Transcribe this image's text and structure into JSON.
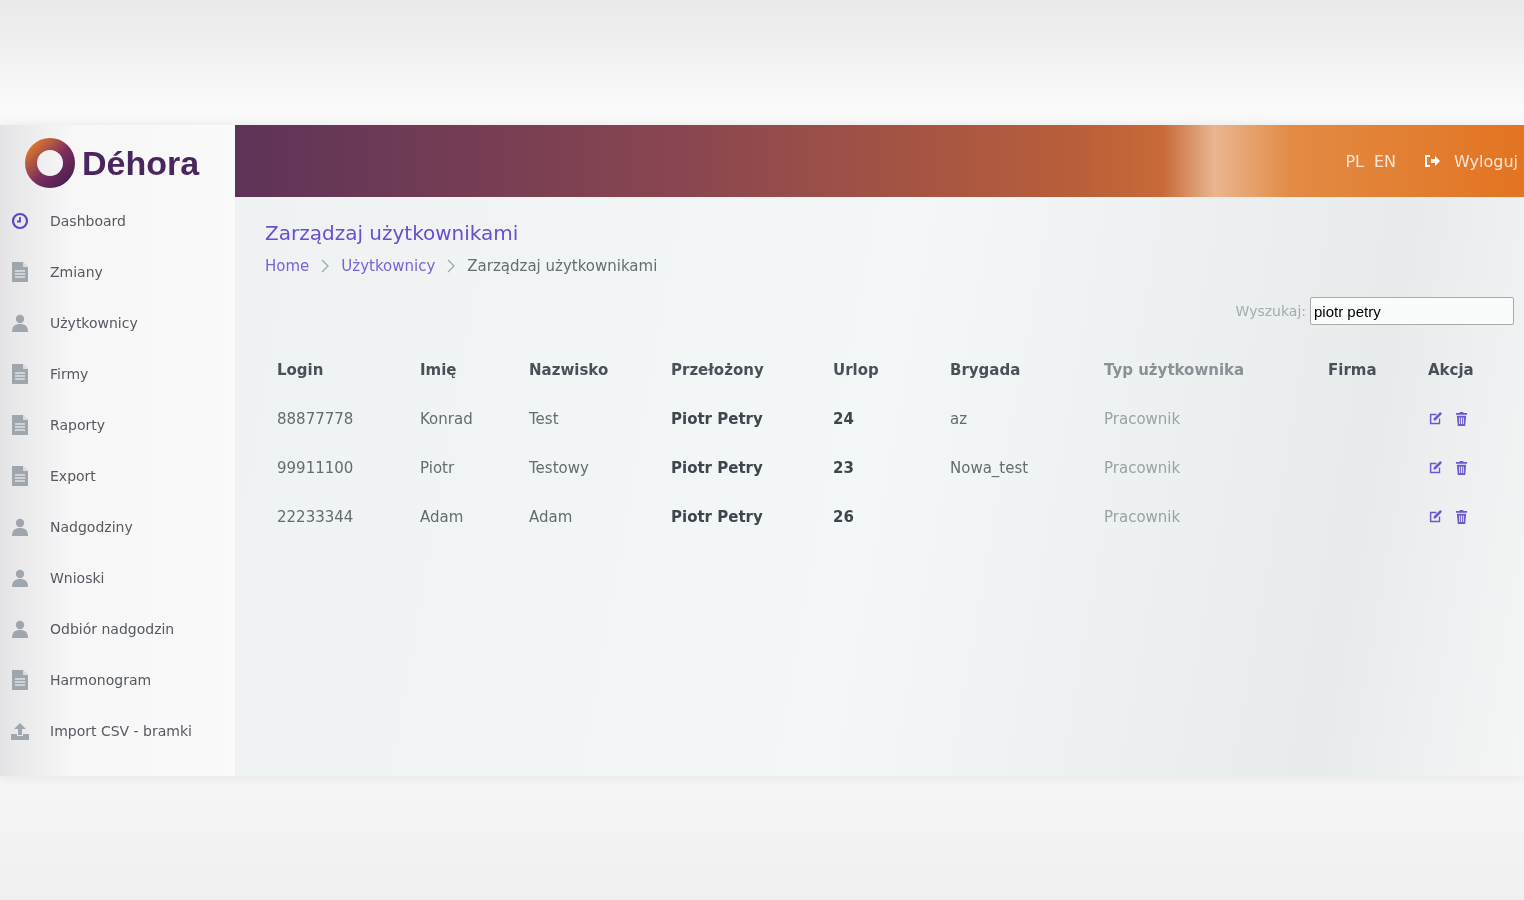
{
  "brand": {
    "name": "Déhora"
  },
  "sidebar": {
    "items": [
      {
        "label": "Dashboard",
        "kind": "clock",
        "selected": true
      },
      {
        "label": "Zmiany",
        "kind": "file",
        "selected": false
      },
      {
        "label": "Użytkownicy",
        "kind": "user",
        "selected": false
      },
      {
        "label": "Firmy",
        "kind": "file",
        "selected": false
      },
      {
        "label": "Raporty",
        "kind": "file",
        "selected": false
      },
      {
        "label": " Export",
        "kind": "file",
        "selected": false
      },
      {
        "label": "Nadgodziny",
        "kind": "user",
        "selected": false
      },
      {
        "label": "Wnioski",
        "kind": "user",
        "selected": false
      },
      {
        "label": "Odbiór nadgodzin",
        "kind": "user",
        "selected": false
      },
      {
        "label": "Harmonogram",
        "kind": "file",
        "selected": false
      },
      {
        "label": "Import CSV - bramki",
        "kind": "upload",
        "selected": false
      }
    ]
  },
  "header": {
    "languages": [
      "PL",
      "EN"
    ],
    "logout": "Wyloguj"
  },
  "page": {
    "title": "Zarządzaj użytkownikami",
    "breadcrumb": [
      "Home",
      "Użytkownicy",
      "Zarządzaj użytkownikami"
    ]
  },
  "search": {
    "label": "Wyszukaj:",
    "value": "piotr petry"
  },
  "table": {
    "columns": [
      "Login",
      "Imię",
      "Nazwisko",
      "Przełożony",
      "Urlop",
      "Brygada",
      "Typ użytkownika",
      "Firma",
      "Akcja"
    ],
    "rows": [
      {
        "cells": [
          "88877778",
          "Konrad",
          "Test",
          "Piotr Petry",
          "24",
          "az",
          "Pracownik",
          ""
        ]
      },
      {
        "cells": [
          "99911100",
          "Piotr",
          "Testowy",
          "Piotr Petry",
          "23",
          "Nowa_test",
          "Pracownik",
          ""
        ]
      },
      {
        "cells": [
          "22233344",
          "Adam",
          "Adam",
          "Piotr Petry",
          "26",
          "",
          "Pracownik",
          ""
        ]
      }
    ]
  }
}
